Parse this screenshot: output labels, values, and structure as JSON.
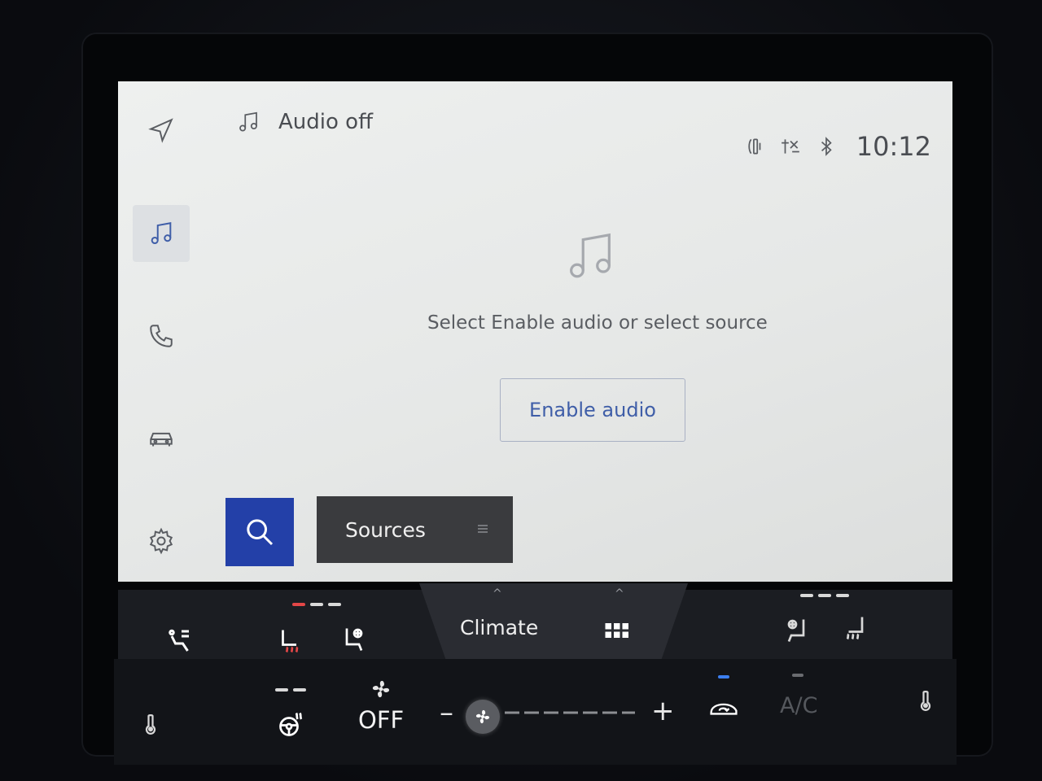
{
  "header": {
    "title": "Audio off",
    "clock": "10:12"
  },
  "main": {
    "message": "Select Enable audio or select source",
    "enable_button_label": "Enable audio"
  },
  "bottom_actions": {
    "sources_label": "Sources"
  },
  "climate": {
    "tab_label": "Climate",
    "fan_state": "OFF",
    "ac_label": "A/C"
  },
  "colors": {
    "accent_blue": "#2340a8",
    "link_blue": "#3f5ea8",
    "heat_red": "#e34747",
    "indicator_blue": "#3c7ff0"
  },
  "icons": {
    "rail": [
      "navigation-icon",
      "music-note-icon",
      "phone-icon",
      "car-icon",
      "gear-icon"
    ],
    "status": [
      "wireless-charging-icon",
      "signal-off-icon",
      "bluetooth-icon"
    ]
  }
}
